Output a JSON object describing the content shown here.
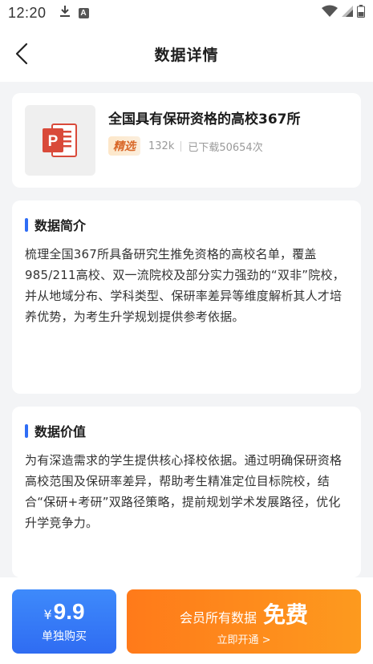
{
  "status_bar": {
    "time": "12:20"
  },
  "nav": {
    "title": "数据详情"
  },
  "file": {
    "title": "全国具有保研资格的高校367所",
    "badge": "精选",
    "size": "132k",
    "downloads": "已下载50654次",
    "icon_letter": "P"
  },
  "intro": {
    "title": "数据简介",
    "body": "梳理全国367所具备研究生推免资格的高校名单，覆盖985/211高校、双一流院校及部分实力强劲的“双非”院校，并从地域分布、学科类型、保研率差异等维度解析其人才培养优势，为考生升学规划提供参考依据。"
  },
  "value": {
    "title": "数据价值",
    "body": "为有深造需求的学生提供核心择校依据。通过明确保研资格高校范围及保研率差异，帮助考生精准定位目标院校，结合“保研+考研”双路径策略，提前规划学术发展路径，优化升学竞争力。"
  },
  "purchase": {
    "currency": "¥",
    "price": "9.9",
    "price_label": "单独购买",
    "vip_text": "会员所有数据",
    "vip_free": "免费",
    "vip_sub": "立即开通 >"
  },
  "colors": {
    "accent_blue": "#2f6df5",
    "accent_orange": "#ff7a1a",
    "ppt_red": "#d94a3a"
  }
}
